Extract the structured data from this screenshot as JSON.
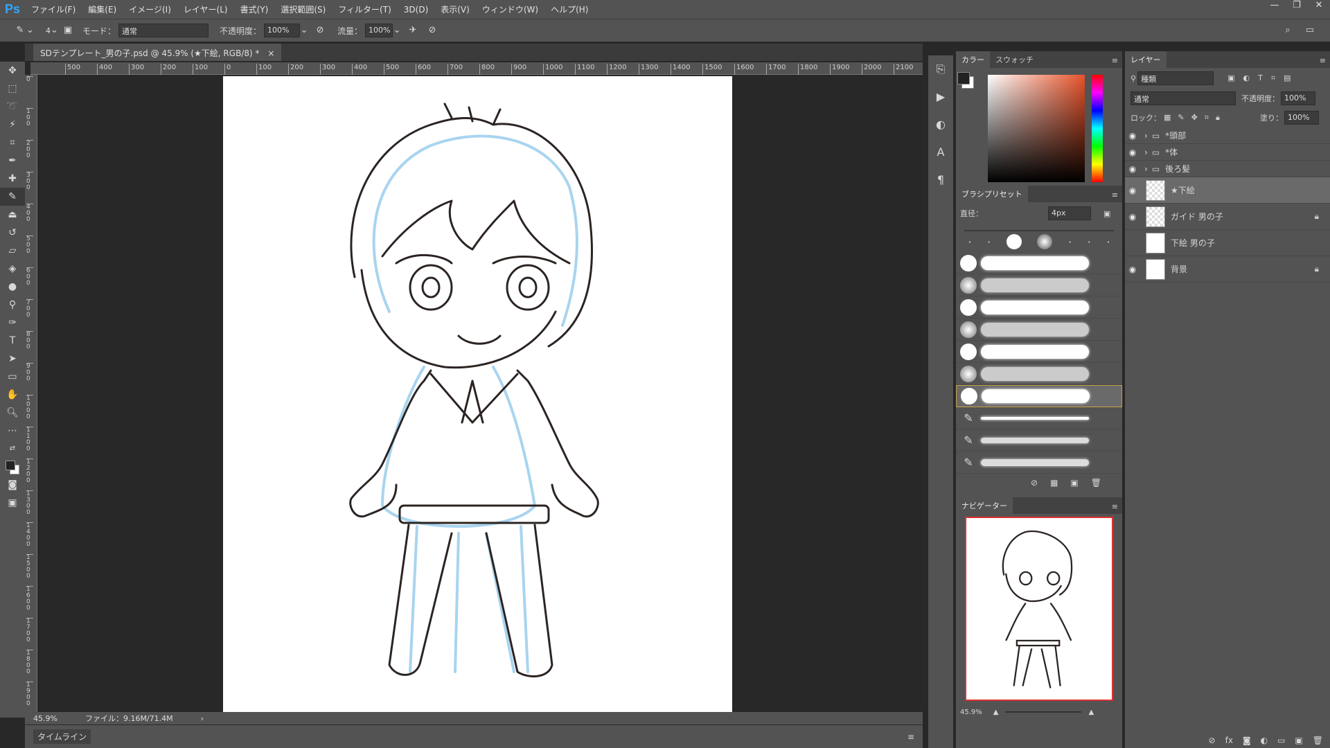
{
  "app": {
    "logo": "Ps"
  },
  "menu": [
    "ファイル(F)",
    "編集(E)",
    "イメージ(I)",
    "レイヤー(L)",
    "書式(Y)",
    "選択範囲(S)",
    "フィルター(T)",
    "3D(D)",
    "表示(V)",
    "ウィンドウ(W)",
    "ヘルプ(H)"
  ],
  "window_controls": [
    "—",
    "❐",
    "✕"
  ],
  "options": {
    "brush_size": "4",
    "mode_label": "モード：",
    "mode_value": "通常",
    "opacity_label": "不透明度：",
    "opacity_value": "100%",
    "flow_label": "流量：",
    "flow_value": "100%"
  },
  "document": {
    "tab_title": "SDテンプレート_男の子.psd @ 45.9% (★下絵, RGB/8) *",
    "close": "×"
  },
  "ruler": {
    "h_ticks": [
      "500",
      "400",
      "300",
      "200",
      "100",
      "0",
      "100",
      "200",
      "300",
      "400",
      "500",
      "600",
      "700",
      "800",
      "900",
      "1000",
      "1100",
      "1200",
      "1300",
      "1400",
      "1500",
      "1600",
      "1700",
      "1800",
      "1900",
      "2000",
      "2100"
    ],
    "v_ticks": [
      "0",
      "100",
      "200",
      "300",
      "400",
      "500",
      "600",
      "700",
      "800",
      "900",
      "1000",
      "1100",
      "1200",
      "1300",
      "1400",
      "1500",
      "1600",
      "1700",
      "1800",
      "1900"
    ]
  },
  "status": {
    "zoom": "45.9%",
    "file_info": "ファイル：9.16M/71.4M",
    "arrow": "›"
  },
  "timeline_label": "タイムライン",
  "color_panel": {
    "tabs": [
      "カラー",
      "スウォッチ"
    ]
  },
  "brush_panel": {
    "title": "ブラシプリセット",
    "diameter_label": "直径：",
    "diameter_value": "4px"
  },
  "navigator": {
    "title": "ナビゲーター",
    "zoom": "45.9%"
  },
  "layers_panel": {
    "title": "レイヤー",
    "filter_label": "種類",
    "blend_mode": "通常",
    "opacity_label": "不透明度：",
    "opacity_value": "100%",
    "lock_label": "ロック：",
    "fill_label": "塗り：",
    "fill_value": "100%",
    "layers": [
      {
        "name": "*頭部",
        "type": "group",
        "visible": true
      },
      {
        "name": "*体",
        "type": "group",
        "visible": true
      },
      {
        "name": "後ろ髪",
        "type": "group",
        "visible": true
      },
      {
        "name": "★下絵",
        "type": "layer",
        "visible": true,
        "selected": true
      },
      {
        "name": "ガイド 男の子",
        "type": "layer",
        "visible": true,
        "locked": true
      },
      {
        "name": "下絵 男の子",
        "type": "layer",
        "visible": false
      },
      {
        "name": "背景",
        "type": "layer",
        "visible": true,
        "locked": true
      }
    ]
  },
  "colors": {
    "accent": "#31a8ff",
    "selected_layer": "#6a6a6a",
    "panel": "#535353"
  }
}
